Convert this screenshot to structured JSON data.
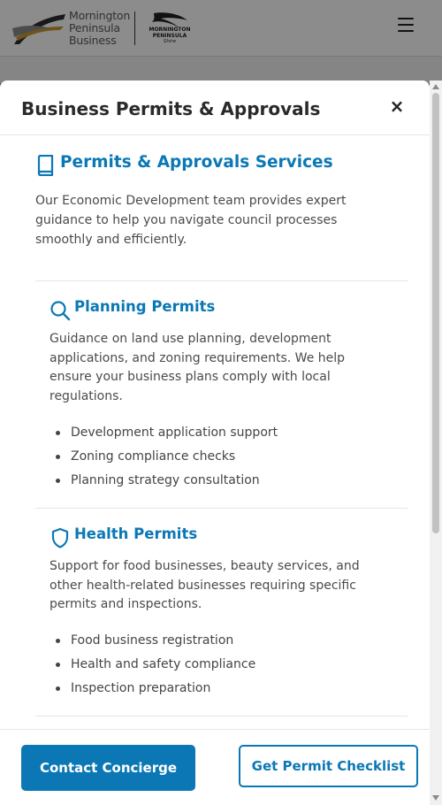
{
  "site": {
    "logo_lines": [
      "Mornington",
      "Peninsula",
      "Business"
    ],
    "shire_lines": [
      "MORNINGTON",
      "PENINSULA",
      "Shire"
    ]
  },
  "modal": {
    "title": "Business Permits & Approvals",
    "close_label": "×",
    "section": {
      "icon": "book-icon",
      "title": "Permits & Approvals Services",
      "intro": "Our Economic Development team provides expert guidance to help you navigate council processes smoothly and efficiently."
    },
    "cards": [
      {
        "icon": "search-icon",
        "title": "Planning Permits",
        "description": "Guidance on land use planning, development applications, and zoning requirements. We help ensure your business plans comply with local regulations.",
        "bullets": [
          "Development application support",
          "Zoning compliance checks",
          "Planning strategy consultation"
        ]
      },
      {
        "icon": "shield-icon",
        "title": "Health Permits",
        "description": "Support for food businesses, beauty services, and other health-related businesses requiring specific permits and inspections.",
        "bullets": [
          "Food business registration",
          "Health and safety compliance",
          "Inspection preparation"
        ]
      }
    ],
    "footer": {
      "primary_label": "Contact Concierge",
      "secondary_label": "Get Permit Checklist"
    }
  },
  "colors": {
    "accent": "#0b78b5",
    "text": "#4a4a4a",
    "title": "#2a2a2a"
  }
}
